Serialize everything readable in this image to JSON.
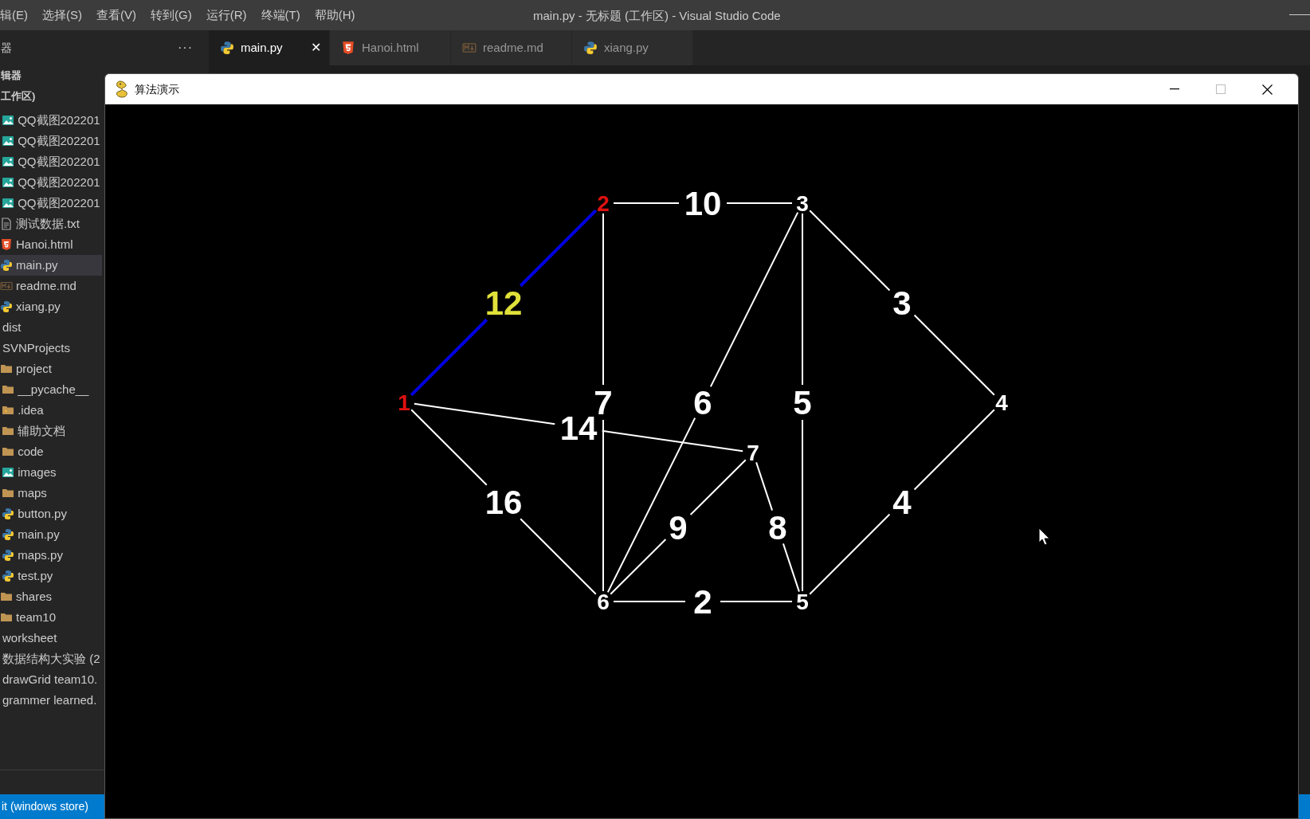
{
  "menu": [
    "辑(E)",
    "选择(S)",
    "查看(V)",
    "转到(G)",
    "运行(R)",
    "终端(T)",
    "帮助(H)"
  ],
  "title": "main.py - 无标题 (工作区) - Visual Studio Code",
  "sidebar": {
    "header": "器",
    "more": "···",
    "section": "辑器",
    "workspace": "工作区)",
    "tree": [
      {
        "children": [
          {
            "children": [
              {
                "label": "QQ截图202201",
                "kind": "image",
                "selected": false
              },
              {
                "label": "QQ截图202201",
                "kind": "image",
                "selected": false
              },
              {
                "label": "QQ截图202201",
                "kind": "image",
                "selected": false
              },
              {
                "label": "QQ截图202201",
                "kind": "image",
                "selected": false
              },
              {
                "label": "QQ截图202201",
                "kind": "image",
                "selected": false
              }
            ]
          },
          {
            "label": "测试数据.txt",
            "kind": "text",
            "selected": false
          },
          {
            "label": "Hanoi.html",
            "kind": "html",
            "selected": false
          },
          {
            "label": "main.py",
            "kind": "python",
            "selected": true
          },
          {
            "label": "readme.md",
            "kind": "markdown",
            "selected": false
          },
          {
            "label": "xiang.py",
            "kind": "python",
            "selected": false
          }
        ]
      },
      {
        "label": "dist",
        "selected": false
      },
      {
        "label": "SVNProjects",
        "selected": false,
        "children": [
          {
            "label": "project",
            "kind": "folder",
            "selected": false,
            "children": [
              {
                "label": "__pycache__",
                "kind": "folder",
                "selected": false
              },
              {
                "label": ".idea",
                "kind": "idea",
                "selected": false
              },
              {
                "label": "辅助文档",
                "kind": "folder",
                "selected": false
              },
              {
                "label": "code",
                "kind": "folder",
                "selected": false
              },
              {
                "label": "images",
                "kind": "image",
                "selected": false
              },
              {
                "label": "maps",
                "kind": "folder",
                "selected": false
              },
              {
                "label": "button.py",
                "kind": "python",
                "selected": false
              },
              {
                "label": "main.py",
                "kind": "python",
                "selected": false
              },
              {
                "label": "maps.py",
                "kind": "python",
                "selected": false
              },
              {
                "label": "test.py",
                "kind": "python",
                "selected": false
              }
            ]
          },
          {
            "label": "shares",
            "kind": "folder",
            "selected": false
          },
          {
            "label": "team10",
            "kind": "folder",
            "selected": false
          }
        ]
      },
      {
        "label": "worksheet",
        "selected": false
      },
      {
        "label": "数据结构大实验 (2",
        "selected": false
      },
      {
        "label": "drawGrid team10.",
        "selected": false
      },
      {
        "label": "grammer learned.",
        "selected": false
      }
    ]
  },
  "tabs": [
    {
      "label": "main.py",
      "kind": "python",
      "selected": true
    },
    {
      "label": "Hanoi.html",
      "kind": "html",
      "selected": false
    },
    {
      "label": "readme.md",
      "kind": "markdown",
      "selected": false
    },
    {
      "label": "xiang.py",
      "kind": "python",
      "selected": false
    }
  ],
  "tab_close": "✕",
  "status_bar": {
    "text": "it (windows store)"
  },
  "popup": {
    "title": "算法演示",
    "graph": {
      "nodes": [
        {
          "label": "1",
          "highlighted": true
        },
        {
          "label": "2",
          "highlighted": true
        },
        {
          "label": "3",
          "highlighted": false
        },
        {
          "label": "4",
          "highlighted": false
        },
        {
          "label": "5",
          "highlighted": false
        },
        {
          "label": "6",
          "highlighted": false
        },
        {
          "label": "7",
          "highlighted": false
        }
      ],
      "edges": [
        {
          "weight": "12",
          "highlighted": true
        },
        {
          "weight": "10",
          "highlighted": false
        },
        {
          "weight": "3",
          "highlighted": false
        },
        {
          "weight": "7",
          "highlighted": false
        },
        {
          "weight": "6",
          "highlighted": false
        },
        {
          "weight": "5",
          "highlighted": false
        },
        {
          "weight": "14",
          "highlighted": false
        },
        {
          "weight": "16",
          "highlighted": false
        },
        {
          "weight": "9",
          "highlighted": false
        },
        {
          "weight": "8",
          "highlighted": false
        },
        {
          "weight": "4",
          "highlighted": false
        },
        {
          "weight": "2",
          "highlighted": false
        }
      ]
    }
  }
}
